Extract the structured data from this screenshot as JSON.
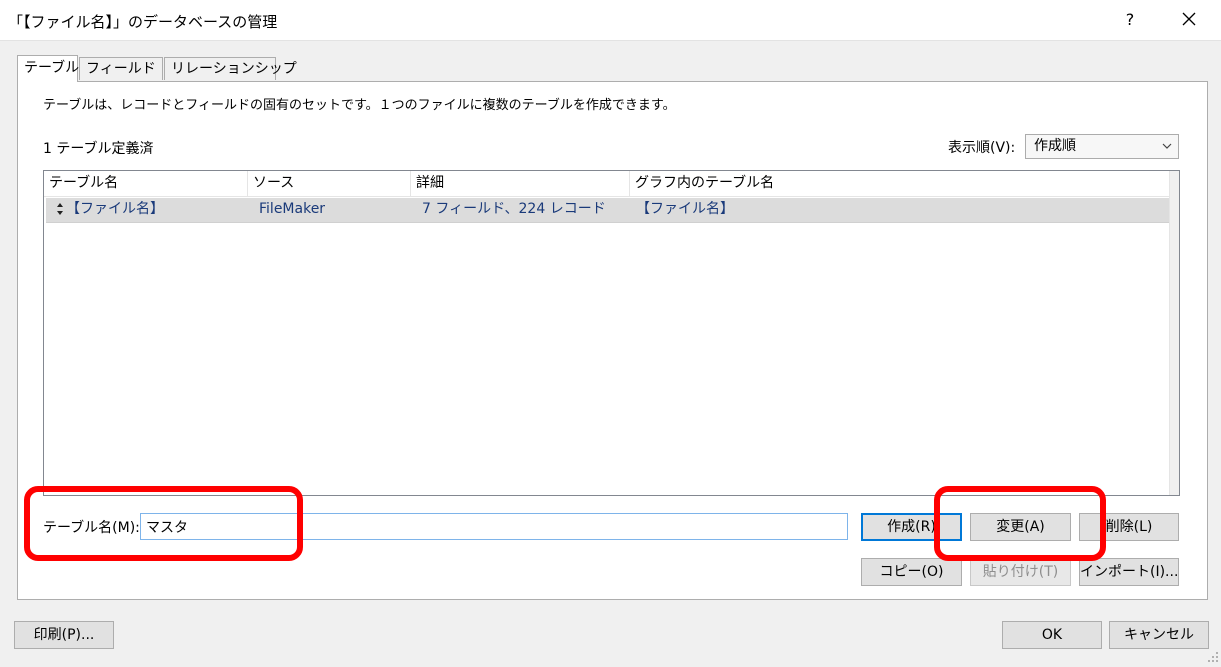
{
  "window": {
    "title": "「【ファイル名】」のデータベースの管理",
    "help_label": "?"
  },
  "tabs": [
    {
      "label": "テーブル",
      "active": true
    },
    {
      "label": "フィールド",
      "active": false
    },
    {
      "label": "リレーションシップ",
      "active": false
    }
  ],
  "panel": {
    "description": "テーブルは、レコードとフィールドの固有のセットです。１つのファイルに複数のテーブルを作成できます。",
    "count_label": "1 テーブル定義済",
    "sort_label": "表示順(V):",
    "sort_value": "作成順"
  },
  "table": {
    "columns": [
      "テーブル名",
      "ソース",
      "詳細",
      "グラフ内のテーブル名"
    ],
    "rows": [
      {
        "name": "【ファイル名】",
        "source": "FileMaker",
        "detail": "7 フィールド、224 レコード",
        "graph_name": "【ファイル名】"
      }
    ]
  },
  "table_name_field": {
    "label": "テーブル名(M):",
    "value": "マスタ"
  },
  "buttons": {
    "create": "作成(R)",
    "change": "変更(A)",
    "delete": "削除(L)",
    "copy": "コピー(O)",
    "paste": "貼り付け(T)",
    "import": "インポート(I)...",
    "print": "印刷(P)...",
    "ok": "OK",
    "cancel": "キャンセル"
  },
  "colors": {
    "highlight": "#ff0000",
    "accent": "#0078d7",
    "selected_row": "#dcdcdc"
  },
  "icons": [
    "close-icon",
    "drag-handle-icon",
    "chevron-down-icon",
    "resize-grip-icon"
  ]
}
